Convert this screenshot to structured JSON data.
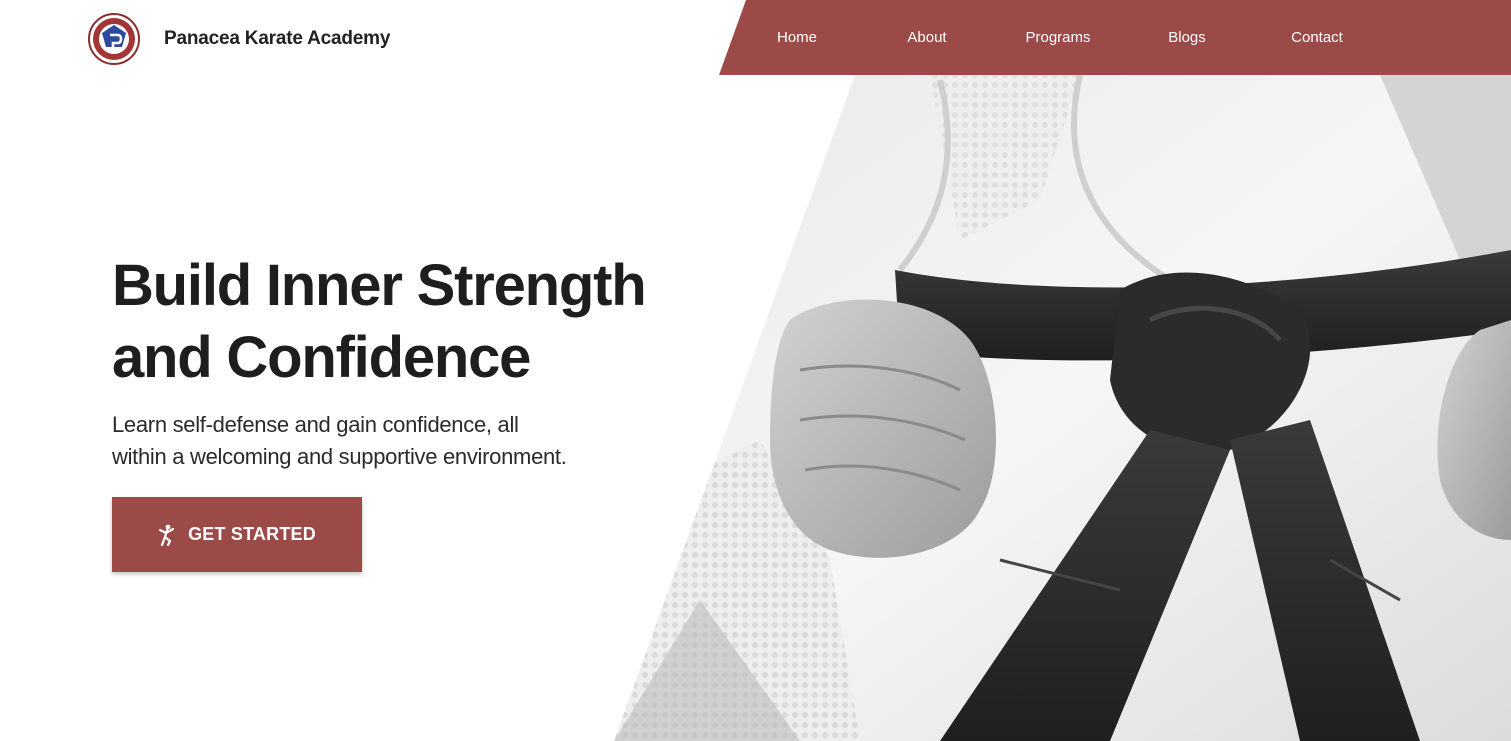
{
  "brand": {
    "name": "Panacea Karate Academy",
    "logo_icon": "academy-emblem-icon"
  },
  "nav": {
    "items": [
      {
        "label": "Home"
      },
      {
        "label": "About"
      },
      {
        "label": "Programs"
      },
      {
        "label": "Blogs"
      },
      {
        "label": "Contact"
      }
    ]
  },
  "hero": {
    "title_line1": "Build Inner Strength",
    "title_line2": "and Confidence",
    "subtitle_line1": "Learn self-defense and gain confidence, all",
    "subtitle_line2": "within a welcoming and supportive environment.",
    "cta_label": "GET STARTED",
    "cta_icon": "martial-arts-kick-icon",
    "image_subject": "karate-gi-black-belt-photo"
  },
  "colors": {
    "accent": "#9b4a47",
    "heading": "#1e1e1e",
    "nav_text": "#ffffff",
    "background": "#ffffff"
  }
}
